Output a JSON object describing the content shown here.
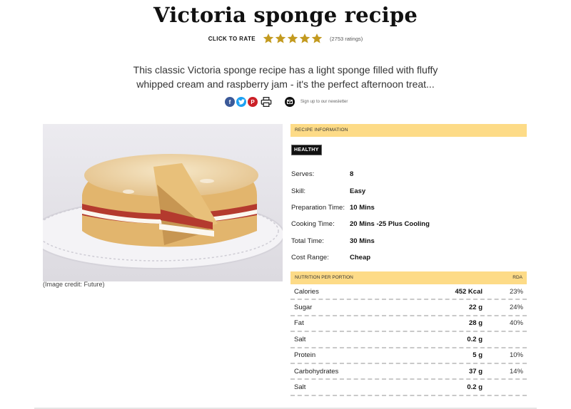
{
  "page": {
    "title": "Victoria sponge recipe",
    "rating": {
      "label": "CLICK TO RATE",
      "stars": 5,
      "count_text": "(2753 ratings)"
    },
    "intro": "This classic Victoria sponge recipe has a light sponge filled with fluffy whipped cream and raspberry jam - it's the perfect afternoon treat...",
    "share": {
      "icons": [
        "facebook-icon",
        "twitter-icon",
        "pinterest-icon",
        "print-icon",
        "email-icon"
      ],
      "newsletter_text": "Sign up to our newsletter"
    },
    "image": {
      "credit": "(Image credit: Future)"
    }
  },
  "recipe_info": {
    "header": "RECIPE INFORMATION",
    "badge": "HEALTHY",
    "rows": [
      {
        "label": "Serves:",
        "value": "8"
      },
      {
        "label": "Skill:",
        "value": "Easy"
      },
      {
        "label": "Preparation Time:",
        "value": "10 Mins"
      },
      {
        "label": "Cooking Time:",
        "value": "20 Mins -25 Plus Cooling"
      },
      {
        "label": "Total Time:",
        "value": "30 Mins"
      },
      {
        "label": "Cost Range:",
        "value": "Cheap"
      }
    ]
  },
  "nutrition": {
    "header": "NUTRITION PER PORTION",
    "rda_header": "RDA",
    "rows": [
      {
        "name": "Calories",
        "amount": "452 Kcal",
        "rda": "23%"
      },
      {
        "name": "Sugar",
        "amount": "22 g",
        "rda": "24%"
      },
      {
        "name": "Fat",
        "amount": "28 g",
        "rda": "40%"
      },
      {
        "name": "Salt",
        "amount": "0.2 g",
        "rda": ""
      },
      {
        "name": "Protein",
        "amount": "5 g",
        "rda": "10%"
      },
      {
        "name": "Carbohydrates",
        "amount": "37 g",
        "rda": "14%"
      },
      {
        "name": "Salt",
        "amount": "0.2 g",
        "rda": ""
      }
    ]
  },
  "colors": {
    "accent_header": "#fddb87",
    "star": "#c39a1f",
    "badge_bg": "#111111"
  }
}
